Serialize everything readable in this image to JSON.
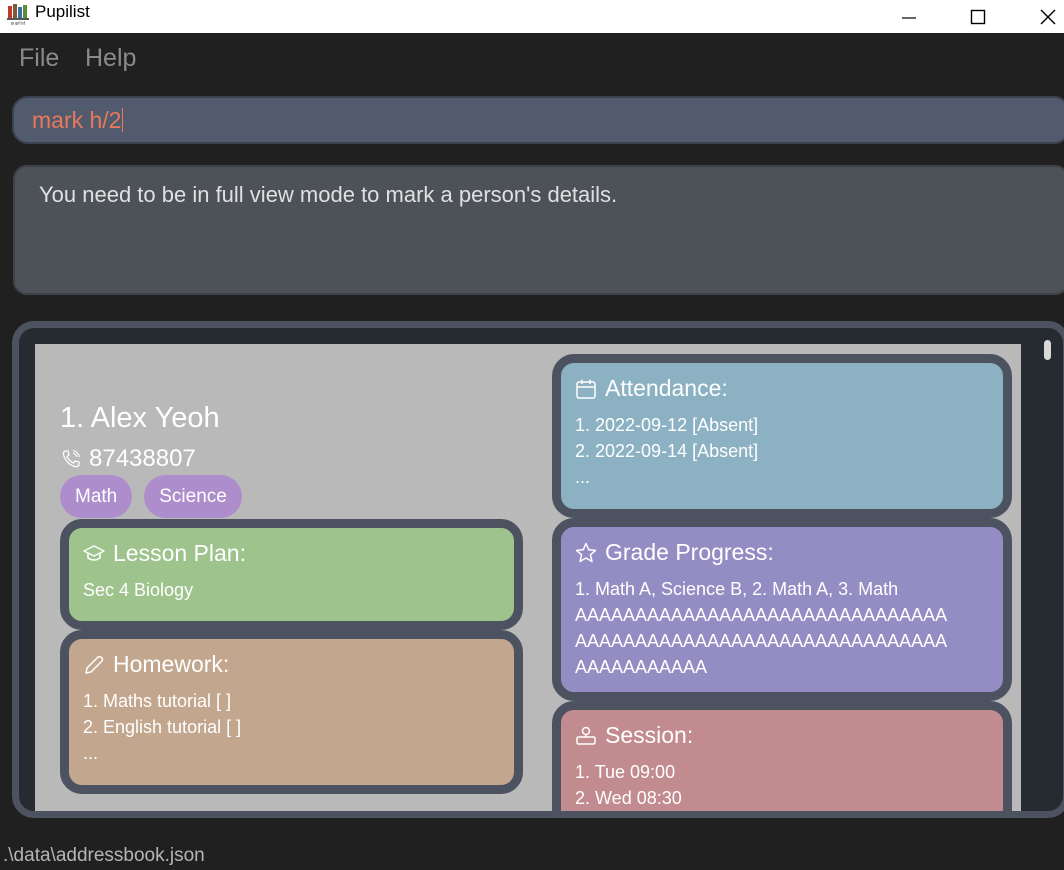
{
  "window": {
    "title": "Pupilist",
    "app_icon": "books-icon",
    "controls": [
      "minimize-icon",
      "maximize-icon",
      "close-icon"
    ]
  },
  "menu": {
    "file": "File",
    "help": "Help"
  },
  "command": {
    "value": "mark h/2"
  },
  "result": {
    "message": "You need to be in full view mode to mark a person's details."
  },
  "person": {
    "index_name": "1.  Alex Yeoh",
    "phone": "87438807",
    "tags": [
      "Math",
      "Science"
    ],
    "lesson_plan": {
      "title": "Lesson Plan:",
      "items": [
        "Sec 4 Biology"
      ]
    },
    "homework": {
      "title": "Homework:",
      "items": [
        "1. Maths tutorial [ ]",
        "2. English tutorial [ ]",
        "..."
      ]
    },
    "attendance": {
      "title": "Attendance:",
      "items": [
        "1. 2022-09-12 [Absent]",
        "2. 2022-09-14 [Absent]",
        "..."
      ]
    },
    "grade_progress": {
      "title": "Grade Progress:",
      "items": [
        "1. Math A, Science B, 2. Math A, 3. Math",
        "AAAAAAAAAAAAAAAAAAAAAAAAAAAAAAA",
        "AAAAAAAAAAAAAAAAAAAAAAAAAAAAAAA",
        "AAAAAAAAAAA"
      ]
    },
    "session": {
      "title": "Session:",
      "items": [
        "1. Tue 09:00",
        "2. Wed 08:30"
      ]
    }
  },
  "colors": {
    "lesson_plan": "#9ec38d",
    "homework": "#c2a68d",
    "attendance": "#8bb1c2",
    "grade_progress": "#948dc3",
    "session": "#c28b8f",
    "tag": "#ad8dcb",
    "command_text": "#e8795a"
  },
  "status": {
    "path": ".\\data\\addressbook.json"
  }
}
